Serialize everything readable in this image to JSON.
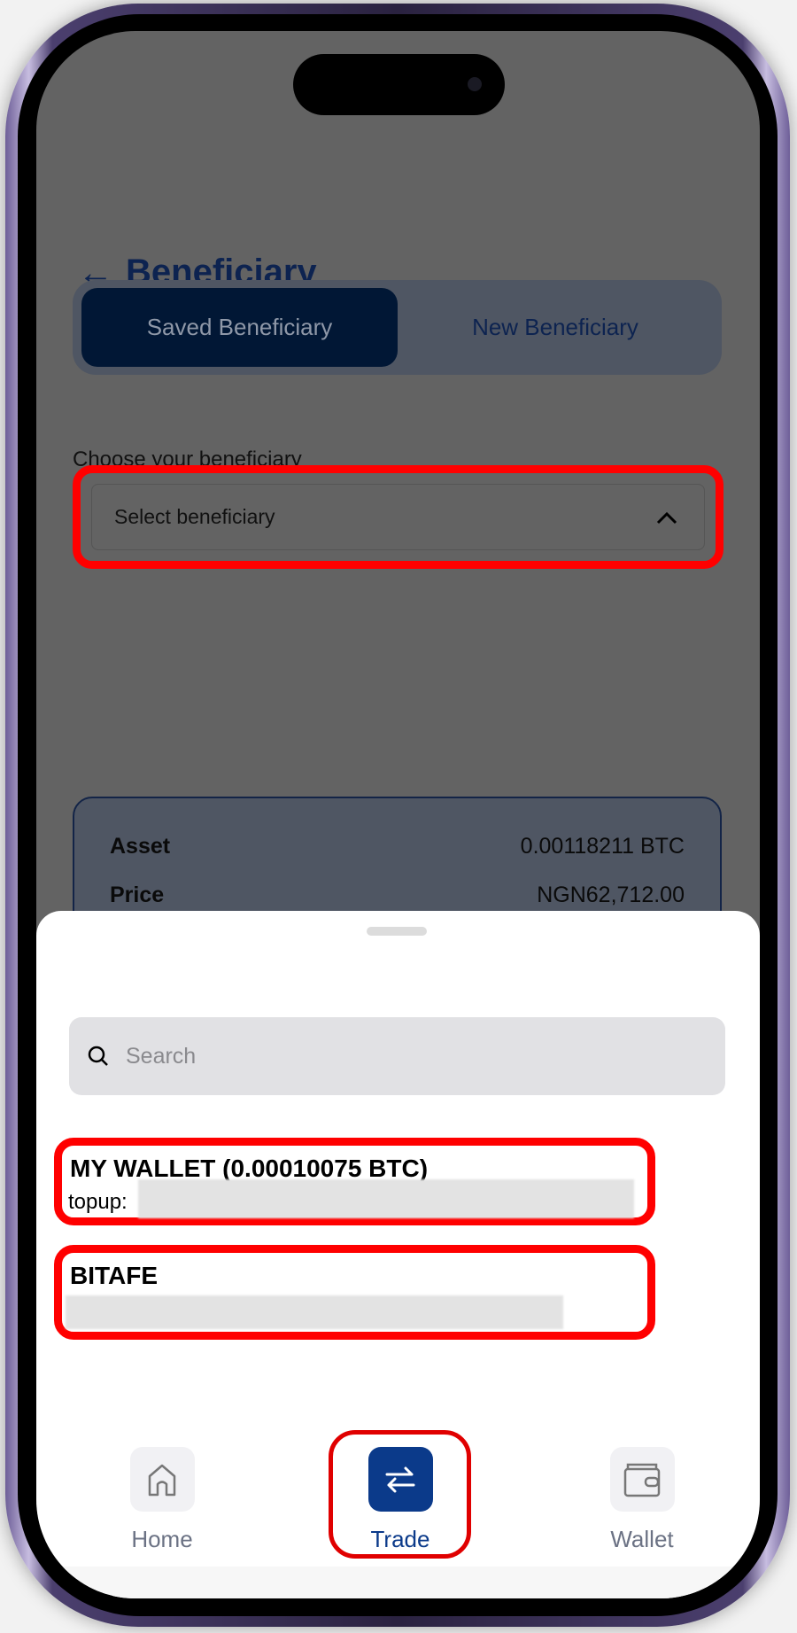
{
  "header": {
    "title": "Beneficiary",
    "back_icon": "arrow-left-icon"
  },
  "tabs": [
    {
      "label": "Saved Beneficiary",
      "selected": true
    },
    {
      "label": "New Beneficiary",
      "selected": false
    }
  ],
  "form": {
    "label": "Choose your beneficiary",
    "dropdown_placeholder": "Select beneficiary",
    "dropdown_icon": "chevron-up-icon"
  },
  "summary": {
    "rows": [
      {
        "label": "Asset",
        "value": "0.00118211 BTC"
      },
      {
        "label": "Price",
        "value": "NGN62,712.00"
      }
    ]
  },
  "sheet": {
    "search_placeholder": "Search",
    "items": [
      {
        "name": "MY WALLET (0.00010075 BTC)",
        "detail_prefix": "topup:"
      },
      {
        "name": "BITAFE"
      }
    ]
  },
  "nav": {
    "items": [
      {
        "label": "Home",
        "icon": "home-icon"
      },
      {
        "label": "Trade",
        "icon": "swap-arrows-icon",
        "active": true
      },
      {
        "label": "Wallet",
        "icon": "wallet-icon"
      }
    ]
  },
  "colors": {
    "accent": "#0b3a8a",
    "highlight": "#ff0000",
    "title": "#0d2350"
  }
}
